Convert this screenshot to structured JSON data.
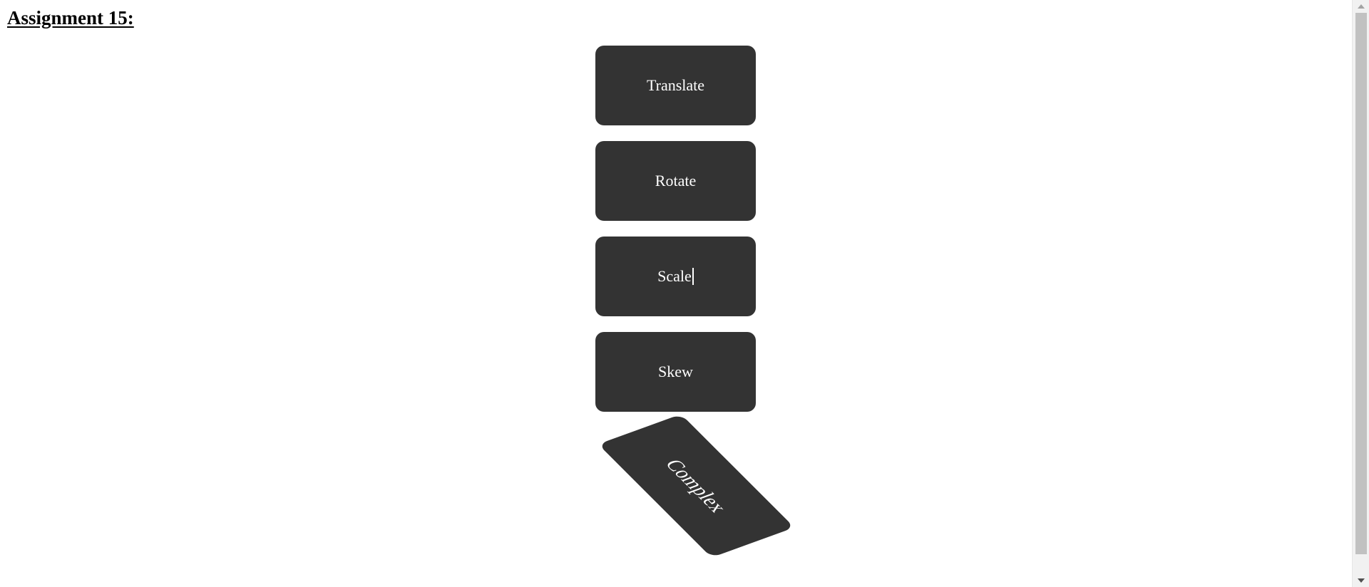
{
  "page": {
    "heading": "Assignment 15:"
  },
  "boxes": {
    "translate": "Translate",
    "rotate": "Rotate",
    "scale": "Scale",
    "skew": "Skew",
    "complex": "Complex"
  },
  "colors": {
    "box_background": "#333333",
    "box_text": "#ffffff",
    "page_background": "#ffffff"
  },
  "scrollbar": {
    "up_icon": "triangle-up-icon",
    "down_icon": "triangle-down-icon"
  }
}
